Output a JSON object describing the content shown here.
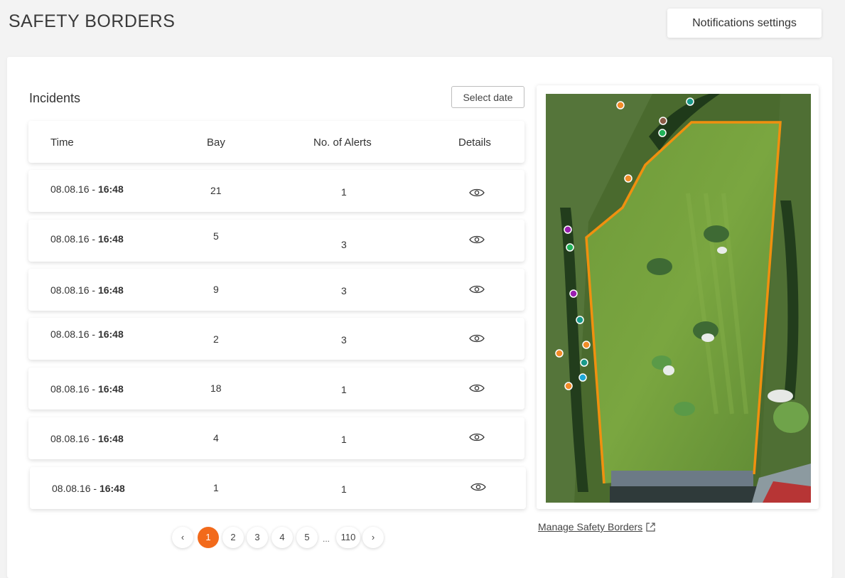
{
  "header": {
    "title": "SAFETY BORDERS",
    "notifications_label": "Notifications settings"
  },
  "incidents": {
    "title": "Incidents",
    "select_date_label": "Select date",
    "columns": [
      "Time",
      "Bay",
      "No. of Alerts",
      "Details"
    ],
    "rows": [
      {
        "date": "08.08.16 - ",
        "time": "16:48",
        "bay": "21",
        "alerts": "1"
      },
      {
        "date": "08.08.16 - ",
        "time": "16:48",
        "bay": "5",
        "alerts": "3"
      },
      {
        "date": "08.08.16 - ",
        "time": "16:48",
        "bay": "9",
        "alerts": "3"
      },
      {
        "date": "08.08.16 - ",
        "time": "16:48",
        "bay": "2",
        "alerts": "3"
      },
      {
        "date": "08.08.16 - ",
        "time": "16:48",
        "bay": "18",
        "alerts": "1"
      },
      {
        "date": "08.08.16 - ",
        "time": "16:48",
        "bay": "4",
        "alerts": "1"
      },
      {
        "date": "08.08.16 - ",
        "time": "16:48",
        "bay": "1",
        "alerts": "1"
      }
    ]
  },
  "pagination": {
    "prev": "‹",
    "pages": [
      "1",
      "2",
      "3",
      "4",
      "5"
    ],
    "ellipsis": "...",
    "last": "110",
    "next": "›",
    "active_page": "1"
  },
  "map": {
    "manage_link": "Manage Safety Borders",
    "border_color": "#f0900f",
    "marker_colors": {
      "orange": "#f28c28",
      "teal": "#1a9a8a",
      "green": "#22b35a",
      "brown": "#8a5a44",
      "purple": "#9a1fb0",
      "cyan": "#1ea8d8"
    }
  },
  "colors": {
    "accent": "#f26a1b"
  }
}
